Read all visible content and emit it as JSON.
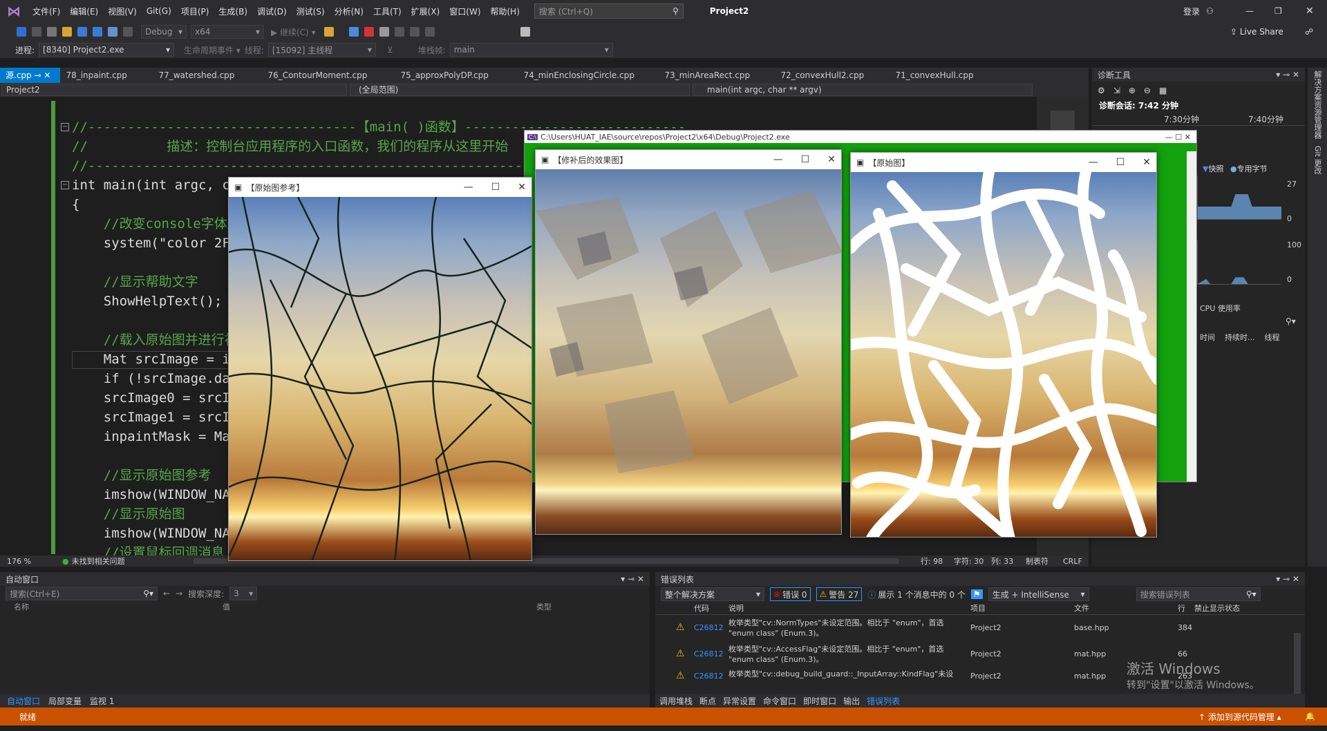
{
  "menu": {
    "items": [
      "文件(F)",
      "编辑(E)",
      "视图(V)",
      "Git(G)",
      "项目(P)",
      "生成(B)",
      "调试(D)",
      "测试(S)",
      "分析(N)",
      "工具(T)",
      "扩展(X)",
      "窗口(W)",
      "帮助(H)"
    ],
    "search_placeholder": "搜索 (Ctrl+Q)",
    "project": "Project2",
    "login": "登录"
  },
  "toolbar": {
    "config": "Debug",
    "platform": "x64",
    "continue": "继续(C)",
    "live_share": "Live Share"
  },
  "debugbar": {
    "process_label": "进程:",
    "process": "[8340] Project2.exe",
    "lifecycle": "生命周期事件",
    "thread_label": "线程:",
    "thread": "[15092] 主线程",
    "stack_label": "堆栈帧:",
    "stack": "main"
  },
  "tabs": [
    "源.cpp",
    "78_inpaint.cpp",
    "77_watershed.cpp",
    "76_ContourMoment.cpp",
    "75_approxPolyDP.cpp",
    "74_minEnclosingCircle.cpp",
    "73_minAreaRect.cpp",
    "72_convexHull2.cpp",
    "71_convexHull.cpp"
  ],
  "nav": {
    "project": "Project2",
    "scope": "(全局范围)",
    "member": "main(int argc, char ** argv)"
  },
  "code": [
    {
      "t": "//----------------------------------【main( )函数】----------------------------",
      "c": "c-green"
    },
    {
      "t": "//          描述：控制台应用程序的入口函数，我们的程序从这里开始",
      "c": "c-green"
    },
    {
      "t": "//------------------------------------------------------------------------",
      "c": "c-green"
    },
    {
      "t": "int main(int argc, char** argv)",
      "c": "c-white"
    },
    {
      "t": "{",
      "c": "c-white"
    },
    {
      "t": "    //改变console字体颜色",
      "c": "c-green"
    },
    {
      "t": "    system(\"color 2F\");",
      "c": "c-white"
    },
    {
      "t": "",
      "c": "c-white"
    },
    {
      "t": "    //显示帮助文字",
      "c": "c-green"
    },
    {
      "t": "    ShowHelpText();",
      "c": "c-white"
    },
    {
      "t": "",
      "c": "c-white"
    },
    {
      "t": "    //载入原始图并进行初始化",
      "c": "c-green"
    },
    {
      "t": "    Mat srcImage = imread(\"1.jpg\", -1);",
      "c": "c-white"
    },
    {
      "t": "    if (!srcImage.data) { printf(\"读取图片错误\\n\"); return false; }",
      "c": "c-white"
    },
    {
      "t": "    srcImage0 = srcImage.clone();",
      "c": "c-white"
    },
    {
      "t": "    srcImage1 = srcImage.clone();",
      "c": "c-white"
    },
    {
      "t": "    inpaintMask = Mat::zeros(srcImage1.size(), CV_8U);",
      "c": "c-white"
    },
    {
      "t": "",
      "c": "c-white"
    },
    {
      "t": "    //显示原始图参考",
      "c": "c-green"
    },
    {
      "t": "    imshow(WINDOW_NAME0, srcImage0);",
      "c": "c-white"
    },
    {
      "t": "    //显示原始图",
      "c": "c-green"
    },
    {
      "t": "    imshow(WINDOW_NAME1, srcImage1);",
      "c": "c-white"
    },
    {
      "t": "    //设置鼠标回调消息",
      "c": "c-green"
    }
  ],
  "editor_status": {
    "zoom": "176 %",
    "issues": "未找到相关问题",
    "line": "行: 98",
    "char": "字符: 30",
    "col": "列: 33",
    "tabs": "制表符",
    "eol": "CRLF"
  },
  "console": {
    "title": "C:\\Users\\HUAT_IAE\\source\\repos\\Project2\\x64\\Debug\\Project2.exe"
  },
  "windows": {
    "ref": "【原始图参考】",
    "repaired": "【修补后的效果图】",
    "orig": "【原始图】"
  },
  "diag": {
    "title": "诊断工具",
    "session": "诊断会话: 7:42 分钟",
    "t1": "7:30分钟",
    "t2": "7:40分钟",
    "snapshot": "快照",
    "private": "专用字节",
    "v27": "27",
    "v0": "0",
    "v100": "100",
    "v0b": "0",
    "cpu": "CPU 使用率",
    "cols": [
      "时间",
      "持续时...",
      "线程"
    ],
    "side1": "解决方案资源管理器",
    "side2": "Git 更改"
  },
  "autos": {
    "title": "自动窗口",
    "search": "搜索(Ctrl+E)",
    "depth_label": "搜索深度:",
    "depth": "3",
    "cols": [
      "名称",
      "值",
      "类型"
    ],
    "tabs": [
      "自动窗口",
      "局部变量",
      "监视 1"
    ]
  },
  "errors": {
    "title": "错误列表",
    "scope": "整个解决方案",
    "errors": "错误 0",
    "warnings": "警告 27",
    "messages": "展示 1 个消息中的 0 个",
    "build": "生成 + IntelliSense",
    "search": "搜索错误列表",
    "cols": [
      "代码",
      "说明",
      "项目",
      "文件",
      "行",
      "禁止显示状态"
    ],
    "rows": [
      {
        "code": "C26812",
        "desc": "枚举类型\"cv::NormTypes\"未设定范围。相比于 \"enum\"，首选 \"enum class\" (Enum.3)。",
        "proj": "Project2",
        "file": "base.hpp",
        "line": "384"
      },
      {
        "code": "C26812",
        "desc": "枚举类型\"cv::AccessFlag\"未设定范围。相比于 \"enum\"，首选 \"enum class\" (Enum.3)。",
        "proj": "Project2",
        "file": "mat.hpp",
        "line": "66"
      },
      {
        "code": "C26812",
        "desc": "枚举类型\"cv::debug_build_guard::_InputArray::KindFlag\"未设",
        "proj": "Project2",
        "file": "mat.hpp",
        "line": "263"
      }
    ],
    "tabs": [
      "调用堆栈",
      "断点",
      "异常设置",
      "命令窗口",
      "即时窗口",
      "输出",
      "错误列表"
    ]
  },
  "watermark": {
    "l1": "激活 Windows",
    "l2": "转到\"设置\"以激活 Windows。"
  },
  "status": {
    "ready": "就绪",
    "source": "添加到源代码管理"
  }
}
